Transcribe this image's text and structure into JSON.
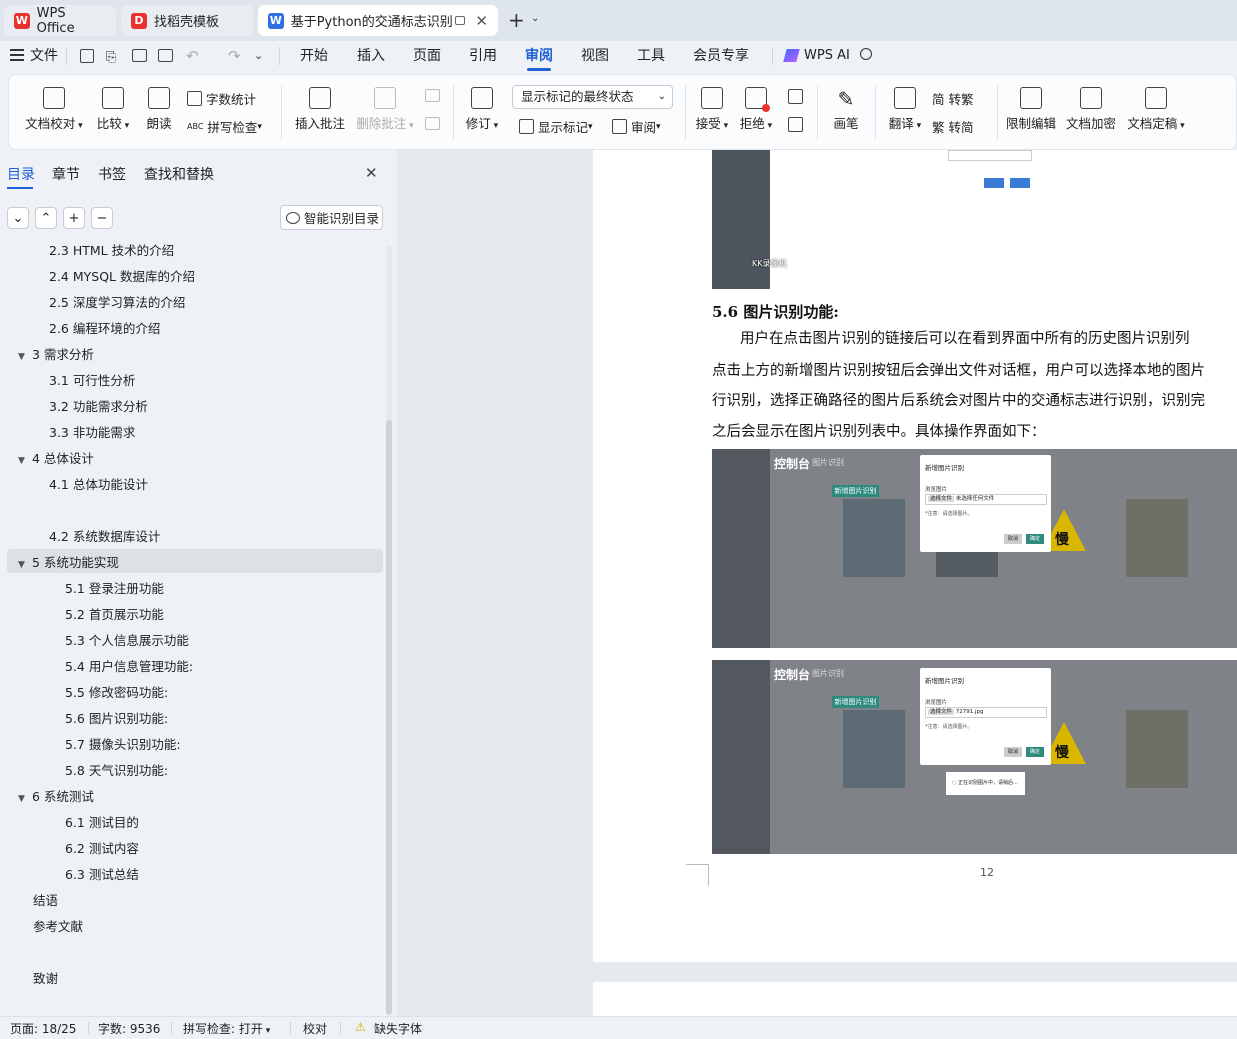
{
  "tabs": [
    {
      "label": "WPS Office"
    },
    {
      "label": "找稻壳模板"
    },
    {
      "label": "基于Python的交通标志识别系"
    }
  ],
  "menu": {
    "file": "文件",
    "items": [
      "开始",
      "插入",
      "页面",
      "引用",
      "审阅",
      "视图",
      "工具",
      "会员专享"
    ],
    "active": "审阅",
    "wps_ai": "WPS AI"
  },
  "ribbon": {
    "doc_check": "文档校对",
    "compare": "比较",
    "read": "朗读",
    "word_count": "字数统计",
    "spell_check": "拼写检查",
    "insert_comment": "插入批注",
    "delete_comment": "删除批注",
    "revise": "修订",
    "markup_state": "显示标记的最终状态",
    "show_markup": "显示标记",
    "review": "审阅",
    "accept": "接受",
    "reject": "拒绝",
    "pen": "画笔",
    "translate": "翻译",
    "to_trad": "转繁",
    "to_simp": "转简",
    "restrict_edit": "限制编辑",
    "encrypt": "文档加密",
    "finalize": "文档定稿"
  },
  "sidebar": {
    "tabs": [
      "目录",
      "章节",
      "书签",
      "查找和替换"
    ],
    "smart_toc": "智能识别目录",
    "toc": [
      {
        "label": "2.3 HTML 技术的介绍"
      },
      {
        "label": "2.4 MYSQL 数据库的介绍"
      },
      {
        "label": "2.5  深度学习算法的介绍"
      },
      {
        "label": "2.6  编程环境的介绍"
      },
      {
        "label": "3  需求分析"
      },
      {
        "label": "3.1  可行性分析"
      },
      {
        "label": "3.2  功能需求分析"
      },
      {
        "label": "3.3  非功能需求"
      },
      {
        "label": "4  总体设计"
      },
      {
        "label": "4.1  总体功能设计"
      },
      {
        "label": "4.2  系统数据库设计"
      },
      {
        "label": "5  系统功能实现"
      },
      {
        "label": "5.1  登录注册功能"
      },
      {
        "label": "5.2  首页展示功能"
      },
      {
        "label": "5.3  个人信息展示功能"
      },
      {
        "label": "5.4  用户信息管理功能:"
      },
      {
        "label": "5.5  修改密码功能:"
      },
      {
        "label": "5.6 图片识别功能:"
      },
      {
        "label": "5.7 摄像头识别功能:"
      },
      {
        "label": "5.8 天气识别功能:"
      },
      {
        "label": "6  系统测试"
      },
      {
        "label": "6.1  测试目的"
      },
      {
        "label": "6.2  测试内容"
      },
      {
        "label": "6.3  测试总结"
      },
      {
        "label": "结语"
      },
      {
        "label": "参考文献"
      },
      {
        "label": "致谢"
      }
    ]
  },
  "document": {
    "heading": "5.6 图片识别功能:",
    "lines": [
      "用户在点击图片识别的链接后可以在看到界面中所有的历史图片识别列",
      "点击上方的新增图片识别按钮后会弹出文件对话框，用户可以选择本地的图片",
      "行识别，选择正确路径的图片后系统会对图片中的交通标志进行识别，识别完",
      "之后会显示在图片识别列表中。具体操作界面如下："
    ],
    "shot_title": "控制台",
    "shot_subtitle": "图片识别",
    "dialog_title": "新增图片识别",
    "dialog_browse": "浏览图片",
    "dialog_choose": "选择文件",
    "dialog_nofile": "未选择任何文件",
    "dialog_file": "72791.jpg",
    "dialog_note": "*注意：请选择图片。",
    "dialog_cancel": "取消",
    "dialog_confirm": "确定",
    "add_button": "新增图片识别",
    "sign_char": "慢",
    "loading": "正在识别图片中，请稍后...",
    "kk_watermark": "KK录像机",
    "page_number": "12"
  },
  "status": {
    "page": "页面: 18/25",
    "words": "字数: 9536",
    "spell": "拼写检查: 打开",
    "proof": "校对",
    "missing_font": "缺失字体"
  }
}
